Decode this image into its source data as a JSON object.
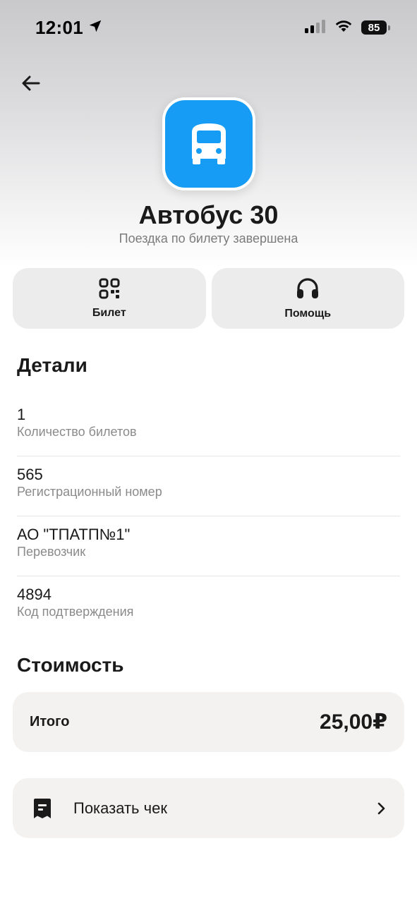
{
  "status_bar": {
    "time": "12:01",
    "battery": "85"
  },
  "header": {
    "title": "Автобус 30",
    "subtitle": "Поездка по билету завершена"
  },
  "actions": [
    {
      "label": "Билет",
      "icon": "qr-code-icon"
    },
    {
      "label": "Помощь",
      "icon": "headset-icon"
    }
  ],
  "details": {
    "title": "Детали",
    "items": [
      {
        "value": "1",
        "label": "Количество билетов"
      },
      {
        "value": "565",
        "label": "Регистрационный номер"
      },
      {
        "value": "АО \"ТПАТП№1\"",
        "label": "Перевозчик"
      },
      {
        "value": "4894",
        "label": "Код подтверждения"
      }
    ]
  },
  "cost": {
    "title": "Стоимость",
    "total_label": "Итого",
    "total_value": "25,00₽"
  },
  "receipt": {
    "label": "Показать чек"
  },
  "colors": {
    "accent": "#169cf5",
    "card_bg": "#f3f2f1",
    "action_bg": "#ececec"
  }
}
